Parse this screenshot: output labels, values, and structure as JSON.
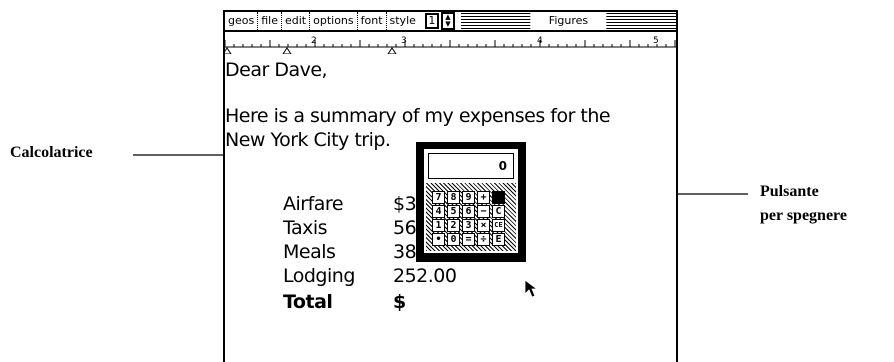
{
  "menu": {
    "items": [
      "geos",
      "file",
      "edit",
      "options",
      "font",
      "style"
    ],
    "font_size": "1",
    "window_title": "Figures"
  },
  "ruler": {
    "marks": [
      "2",
      "3",
      "4",
      "5"
    ]
  },
  "document": {
    "greeting": "Dear Dave,",
    "body_line1": "Here is a summary of my expenses for the",
    "body_line2": "New York City trip.",
    "expenses": [
      {
        "label": "Airfare",
        "value": "$3"
      },
      {
        "label": "Taxis",
        "value": "56"
      },
      {
        "label": "Meals",
        "value": "38"
      },
      {
        "label": "Lodging",
        "value": "252.00"
      }
    ],
    "total_label": "Total",
    "total_value": "$"
  },
  "calculator": {
    "display": "0",
    "keys": [
      [
        "7",
        "8",
        "9",
        "+",
        " "
      ],
      [
        "4",
        "5",
        "6",
        "−",
        "C"
      ],
      [
        "1",
        "2",
        "3",
        "×",
        "CE"
      ],
      [
        "•",
        "0",
        "=",
        "÷",
        "E"
      ]
    ]
  },
  "callouts": {
    "left": "Calcolatrice",
    "right_line1": "Pulsante",
    "right_line2": "per spegnere"
  }
}
